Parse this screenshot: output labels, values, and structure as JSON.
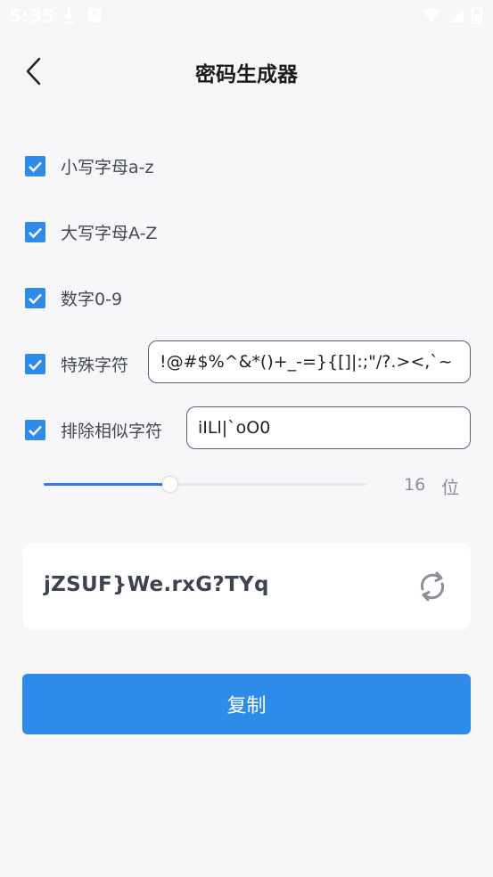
{
  "status_bar": {
    "time": "5:35"
  },
  "header": {
    "title": "密码生成器"
  },
  "options": [
    {
      "label": "小写字母a-z",
      "checked": true
    },
    {
      "label": "大写字母A-Z",
      "checked": true
    },
    {
      "label": "数字0-9",
      "checked": true
    },
    {
      "label": "特殊字符",
      "checked": true,
      "field_value": "!@#$%^&*()+_-=}{[]|:;\"/?.><,`~"
    },
    {
      "label": "排除相似字符",
      "checked": true,
      "field_value": "iILl|`oO0"
    }
  ],
  "length": {
    "value": "16",
    "unit": "位",
    "fraction": 0.39
  },
  "result": {
    "password": "jZSUF}We.rxG?TYq"
  },
  "copy_button": {
    "label": "复制"
  },
  "colors": {
    "accent": "#2f8bea",
    "background": "#f7f7f9"
  }
}
